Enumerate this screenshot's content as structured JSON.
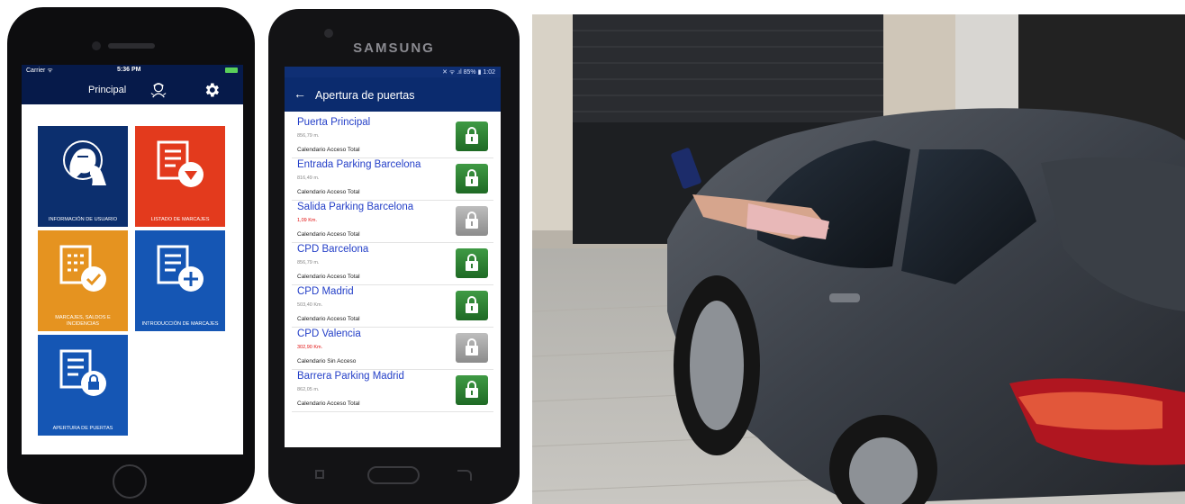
{
  "iphone": {
    "status": {
      "carrier": "Carrier ᯤ",
      "time": "5:36 PM"
    },
    "nav_title": "Principal",
    "tiles": [
      {
        "label": "INFORMACIÓN DE USUARIO",
        "color": "#0c2f6e"
      },
      {
        "label": "LISTADO DE MARCAJES",
        "color": "#e33a1d"
      },
      {
        "label": "MARCAJES, SALDOS E INCIDENCIAS",
        "color": "#e59320"
      },
      {
        "label": "INTRODUCCIÓN DE MARCAJES",
        "color": "#1556b4"
      },
      {
        "label": "APERTURA DE PUERTAS",
        "color": "#1556b4"
      }
    ]
  },
  "samsung": {
    "brand": "SAMSUNG",
    "status": "✕ ᯤ .ıl 85% ▮ 1:02",
    "title": "Apertura de puertas",
    "doors": [
      {
        "name": "Puerta Principal",
        "distance": "856,79 m.",
        "calendar": "Calendario Acceso Total",
        "state": "enabled"
      },
      {
        "name": "Entrada Parking Barcelona",
        "distance": "816,49 m.",
        "calendar": "Calendario Acceso Total",
        "state": "enabled"
      },
      {
        "name": "Salida Parking Barcelona",
        "distance": "1,09 Km.",
        "calendar": "Calendario Acceso Total",
        "state": "disabled"
      },
      {
        "name": "CPD Barcelona",
        "distance": "856,79 m.",
        "calendar": "Calendario Acceso Total",
        "state": "enabled"
      },
      {
        "name": "CPD Madrid",
        "distance": "503,40 Km.",
        "calendar": "Calendario Acceso Total",
        "state": "enabled"
      },
      {
        "name": "CPD Valencia",
        "distance": "302,90 Km.",
        "calendar": "Calendario Sin Acceso",
        "state": "disabled"
      },
      {
        "name": "Barrera Parking Madrid",
        "distance": "862,05 m.",
        "calendar": "Calendario Acceso Total",
        "state": "enabled"
      }
    ]
  },
  "colors": {
    "navy": "#061a4a",
    "android_bar": "#0b2b6e",
    "door_link": "#2540c8",
    "lock_enabled": "#2e7d32",
    "lock_disabled": "#9a9a9a",
    "distance_alert": "#e01010"
  }
}
